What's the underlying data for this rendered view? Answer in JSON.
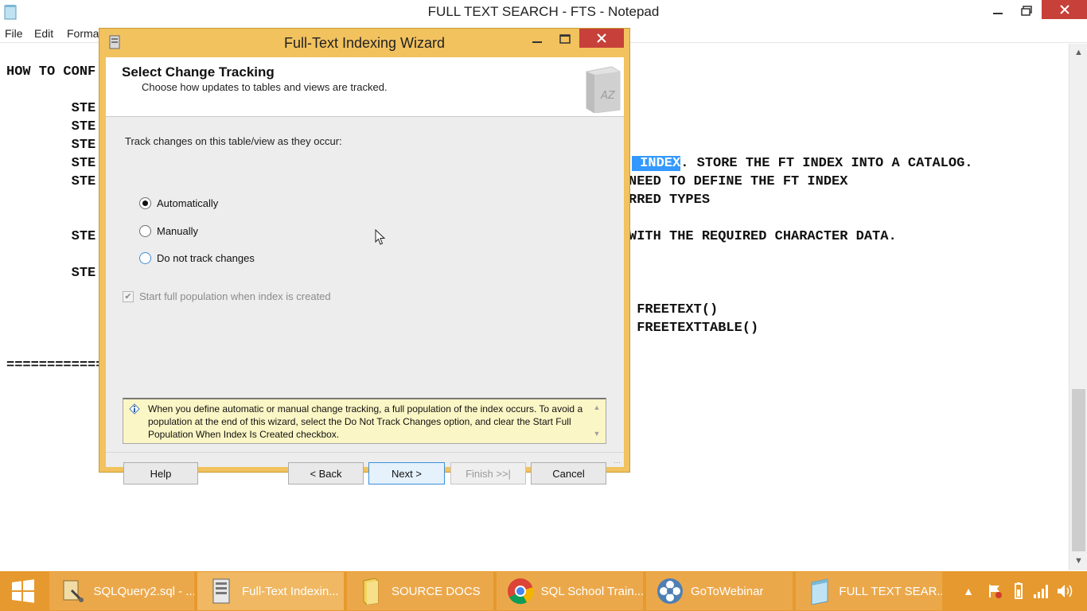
{
  "notepad": {
    "title": "FULL TEXT SEARCH - FTS - Notepad",
    "menu": [
      "File",
      "Edit",
      "Forma"
    ],
    "lines": [
      {
        "prefix": "HOW TO CONF",
        "selected": "",
        "suffix": ""
      },
      {
        "prefix": "        STE",
        "selected": "",
        "suffix": ""
      },
      {
        "prefix": "        STE",
        "selected": "",
        "suffix": ""
      },
      {
        "prefix": "        STE",
        "selected": "",
        "suffix": ""
      },
      {
        "prefix": "        STE",
        "selected": "",
        "suffix": ""
      },
      {
        "prefix": "        STE",
        "selected": "",
        "suffix": ""
      },
      {
        "prefix": "        STE",
        "selected": "",
        "suffix": ""
      },
      {
        "prefix": "============",
        "selected": "",
        "suffix": ""
      }
    ],
    "right_lines": [
      {
        "prefix": "",
        "selected": " INDEX",
        "suffix": ". STORE THE FT INDEX INTO A CATALOG."
      },
      {
        "prefix": "NEED TO DEFINE THE FT INDEX",
        "selected": "",
        "suffix": ""
      },
      {
        "prefix": "RRED TYPES",
        "selected": "",
        "suffix": ""
      },
      {
        "prefix": "WITH THE REQUIRED CHARACTER DATA.",
        "selected": "",
        "suffix": ""
      },
      {
        "prefix": " FREETEXT()",
        "selected": "",
        "suffix": ""
      },
      {
        "prefix": " FREETEXTTABLE()",
        "selected": "",
        "suffix": ""
      }
    ]
  },
  "wizard": {
    "title": "Full-Text Indexing Wizard",
    "heading": "Select Change Tracking",
    "subheading": "Choose how updates to tables and views are tracked.",
    "prompt": "Track changes on this table/view as they occur:",
    "options": [
      {
        "label": "Automatically",
        "selected": true
      },
      {
        "label": "Manually",
        "selected": false
      },
      {
        "label": "Do not track changes",
        "selected": false
      }
    ],
    "checkbox_label": "Start full population when index is created",
    "checkbox_checked": true,
    "info_text": "When you define automatic or manual change tracking, a full population of the index occurs. To avoid a population at the end of this wizard, select the Do Not Track Changes option, and clear the Start Full Population When Index Is Created checkbox.",
    "buttons": {
      "help": "Help",
      "back": "< Back",
      "next": "Next >",
      "finish": "Finish >>|",
      "cancel": "Cancel"
    }
  },
  "taskbar": {
    "items": [
      {
        "label": "SQLQuery2.sql - ...",
        "icon": "sql-query-icon"
      },
      {
        "label": "Full-Text Indexin...",
        "icon": "wizard-app-icon"
      },
      {
        "label": "SOURCE DOCS",
        "icon": "folder-icon"
      },
      {
        "label": "SQL School Train...",
        "icon": "chrome-icon"
      },
      {
        "label": "GoToWebinar",
        "icon": "gotowebinar-icon"
      },
      {
        "label": "FULL TEXT SEAR...",
        "icon": "notepad-icon"
      }
    ]
  },
  "colors": {
    "taskbar": "#e6992e",
    "wizard_frame": "#f2c25e",
    "close_red": "#c7403a",
    "selection": "#3399ff"
  }
}
